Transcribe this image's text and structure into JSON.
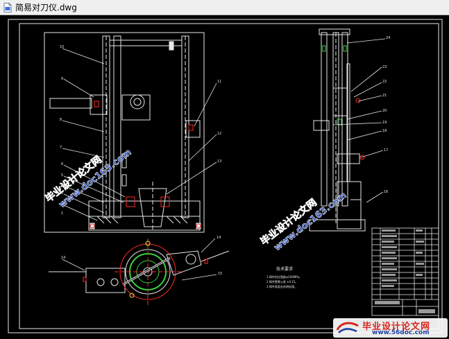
{
  "window": {
    "title": "简易对刀仪.dwg",
    "icon": "dwg-file-icon"
  },
  "drawing": {
    "part_labels_front": [
      "10",
      "9",
      "8",
      "7",
      "6",
      "5",
      "4",
      "3",
      "2",
      "1",
      "11",
      "12",
      "13"
    ],
    "part_labels_side": [
      "24",
      "23",
      "22",
      "21",
      "20",
      "19",
      "18",
      "17",
      "16"
    ],
    "part_labels_top": [
      "14",
      "14",
      "15"
    ],
    "tech_requirements_title": "技术要求",
    "tech_requirements_lines": [
      "1.铸件抗拉强度≥200MPa。",
      "2.铸件壁厚公差 ±0.15。",
      "3.铸件表面去毛刺处理。"
    ]
  },
  "watermarks": {
    "brand": "毕业设计论文网",
    "url": "www.doc163.com"
  },
  "footer_logo": {
    "title": "毕业设计论文网",
    "url": "www.56doc.com"
  },
  "colors": {
    "background": "#000000",
    "line_white": "#e8e8e8",
    "line_red": "#ff2a2a",
    "line_green": "#36d23a",
    "line_yellow": "#e8e030",
    "watermark_red": "#e0231e",
    "watermark_blue": "#2a4fbf"
  }
}
